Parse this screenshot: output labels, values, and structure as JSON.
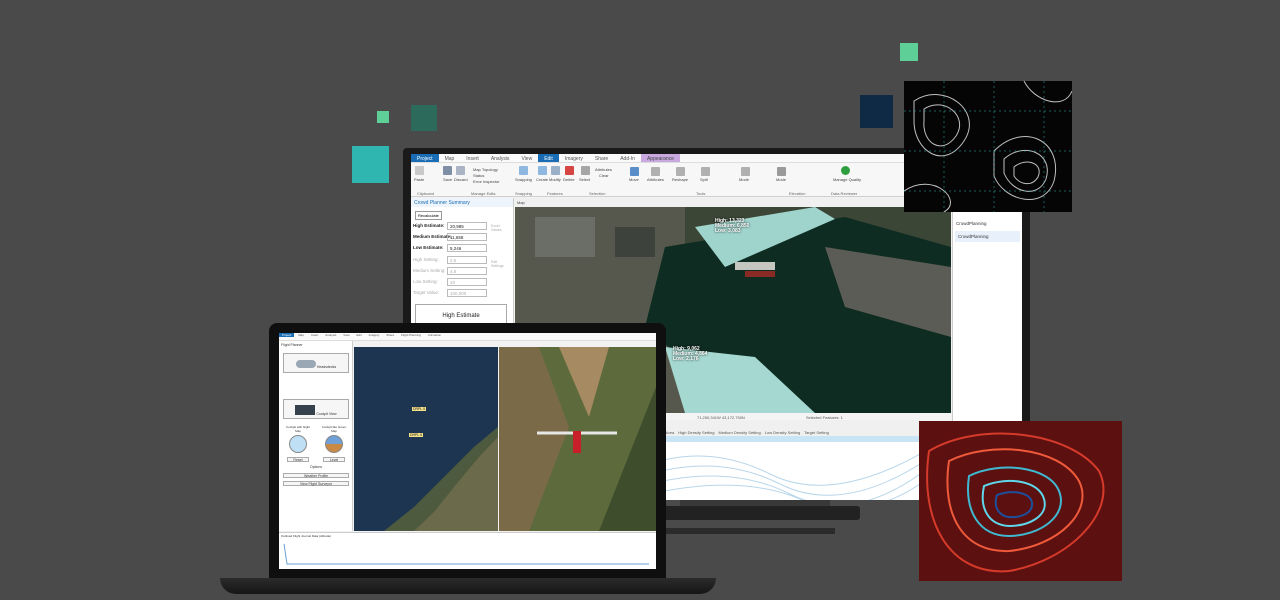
{
  "colors": {
    "background": "#4a4a4a",
    "accent_teal": "#2fb6b1",
    "accent_green": "#5fcf98",
    "navy": "#0e2a44",
    "ribbon_blue": "#1a6db5"
  },
  "monitor": {
    "tabs": [
      "Project",
      "Map",
      "Insert",
      "Analysis",
      "View",
      "Edit",
      "Imagery",
      "Share",
      "Add-In",
      "Appearance"
    ],
    "ribbon": {
      "groups": [
        "Clipboard",
        "Manage Edits",
        "Snapping",
        "Features",
        "Selection",
        "Tools",
        "Elevation",
        "Data Reviewer"
      ],
      "buttons": [
        "Paste",
        "Save",
        "Discard",
        "Map Topology",
        "Status",
        "Error Inspector",
        "Snapping",
        "Create",
        "Modify",
        "Delete",
        "Select",
        "Attributes",
        "Clear",
        "Move",
        "Attributes",
        "Reshape",
        "Split",
        "Vertices",
        "Mode",
        "Manage Quality"
      ]
    },
    "panel": {
      "title": "Crowd Planner Summary",
      "recalc_button": "Recalculate",
      "rows": [
        {
          "label": "High Estimate:",
          "value": "20,985"
        },
        {
          "label": "Medium Estimate:",
          "value": "11,658"
        },
        {
          "label": "Low Estimate:",
          "value": "5,246"
        }
      ],
      "settings": [
        {
          "label": "High Setting:",
          "value": "2.5"
        },
        {
          "label": "Medium Setting:",
          "value": "4.5"
        },
        {
          "label": "Low Setting:",
          "value": "10"
        },
        {
          "label": "Target Value:",
          "value": "100,000"
        }
      ],
      "side_labels": [
        "Excel Values",
        "Edit Settings"
      ],
      "high_estimate_box": "High Estimate"
    },
    "map_tab": "Map",
    "map_labels": [
      "High: 13,323\nMedium: 6,850\nLow: 3,083",
      "High: 9,062\nMedium: 4,864\nLow: 2,176"
    ],
    "status_bar": "71,250,341W 43,172,750N",
    "status_right": "Selected Features: 1",
    "right_panel": {
      "title": "CrowdPlanning",
      "item": "CrowdPlanning"
    },
    "table_headers": [
      "Shape_Area",
      "High Density Setting",
      "Medium Density Setting",
      "Low Density Setting",
      "Target Setting"
    ],
    "table_tab": "Outline"
  },
  "laptop": {
    "tabs": [
      "Project",
      "Map",
      "Insert",
      "Analysis",
      "View",
      "Edit",
      "Imagery",
      "Share",
      "Flight Planning",
      "Animation"
    ],
    "panel_title": "Flight Planner",
    "buttons": [
      "Headsdecks",
      "Cockpit View",
      "Reset",
      "Level"
    ],
    "labels": [
      "Cockpit with Night Map",
      "Cockpit like Green Map",
      "Options"
    ],
    "option_buttons": [
      "Weather Profile",
      "View Flight Surveyor"
    ],
    "tags": [
      "DRPL 5",
      "DRPL 6"
    ],
    "bottom_title": "Outlined Flight Journal Data (Altitude)"
  }
}
